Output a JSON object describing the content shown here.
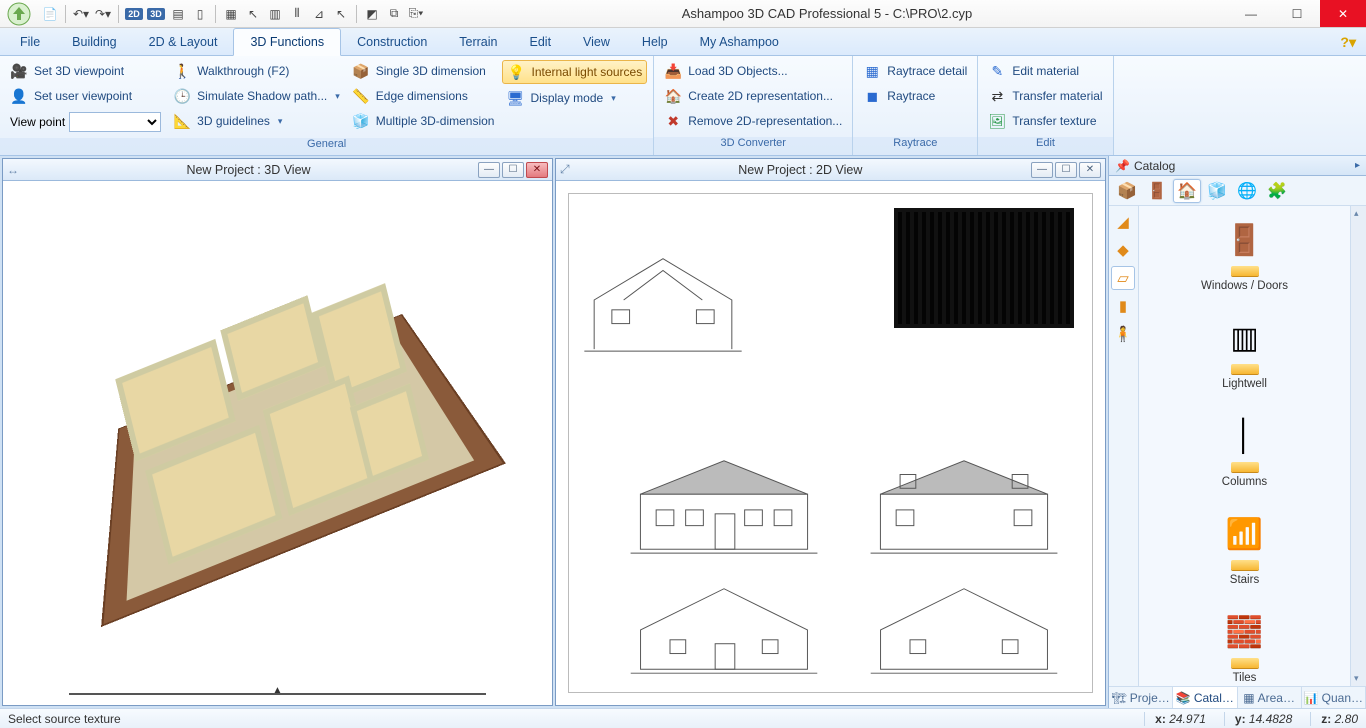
{
  "window": {
    "title": "Ashampoo 3D CAD Professional 5 - C:\\PRO\\2.cyp"
  },
  "menutabs": {
    "file": "File",
    "items": [
      "Building",
      "2D & Layout",
      "3D Functions",
      "Construction",
      "Terrain",
      "Edit",
      "View",
      "Help",
      "My Ashampoo"
    ],
    "active_index": 2
  },
  "ribbon": {
    "groups": [
      {
        "label": "General",
        "columns": [
          {
            "items": [
              {
                "icon": "🎥",
                "cls": "c-dark",
                "text": "Set 3D viewpoint"
              },
              {
                "icon": "👤",
                "cls": "c-dark",
                "text": "Set user viewpoint"
              },
              {
                "viewpoint_label": "View point"
              }
            ]
          },
          {
            "items": [
              {
                "icon": "🚶",
                "cls": "c-green",
                "text": "Walkthrough (F2)"
              },
              {
                "icon": "🕒",
                "cls": "c-orange",
                "text": "Simulate Shadow path...",
                "dd": true
              },
              {
                "icon": "📐",
                "cls": "c-green",
                "text": "3D guidelines",
                "dd": true
              }
            ]
          },
          {
            "items": [
              {
                "icon": "📦",
                "cls": "c-orange",
                "text": "Single 3D dimension"
              },
              {
                "icon": "📏",
                "cls": "c-blue",
                "text": "Edge dimensions"
              },
              {
                "icon": "🧊",
                "cls": "c-orange",
                "text": "Multiple 3D-dimension"
              }
            ]
          },
          {
            "items": [
              {
                "icon": "💡",
                "cls": "c-orange",
                "text": "Internal light sources",
                "highlight": true
              },
              {
                "icon": "🖥",
                "cls": "c-blue",
                "text": "Display mode",
                "dd": true
              }
            ]
          }
        ]
      },
      {
        "label": "3D Converter",
        "columns": [
          {
            "items": [
              {
                "icon": "📥",
                "cls": "c-orange",
                "text": "Load 3D Objects..."
              },
              {
                "icon": "🏠",
                "cls": "c-blue",
                "text": "Create 2D representation..."
              },
              {
                "icon": "✖",
                "cls": "c-red",
                "text": "Remove 2D-representation..."
              }
            ]
          }
        ]
      },
      {
        "label": "Raytrace",
        "columns": [
          {
            "items": [
              {
                "icon": "▦",
                "cls": "c-blue",
                "text": "Raytrace detail"
              },
              {
                "icon": "◼",
                "cls": "c-blue",
                "text": "Raytrace"
              }
            ]
          }
        ]
      },
      {
        "label": "Edit",
        "columns": [
          {
            "items": [
              {
                "icon": "✎",
                "cls": "c-blue",
                "text": "Edit material"
              },
              {
                "icon": "⇄",
                "cls": "c-dark",
                "text": "Transfer material"
              },
              {
                "icon": "🖼",
                "cls": "c-green",
                "text": "Transfer texture"
              }
            ]
          }
        ]
      }
    ]
  },
  "views": {
    "left": {
      "title": "New Project : 3D View"
    },
    "right": {
      "title": "New Project : 2D View"
    }
  },
  "catalog": {
    "title": "Catalog",
    "items": [
      {
        "label": "Windows / Doors",
        "glyph": "🚪"
      },
      {
        "label": "Lightwell",
        "glyph": "▥"
      },
      {
        "label": "Columns",
        "glyph": "│"
      },
      {
        "label": "Stairs",
        "glyph": "📶"
      },
      {
        "label": "Tiles",
        "glyph": "🧱"
      }
    ],
    "bottom_tabs": [
      "Proje…",
      "Catal…",
      "Area…",
      "Quan…"
    ],
    "bottom_active": 1
  },
  "status": {
    "message": "Select source texture",
    "x_label": "x:",
    "x": "24.971",
    "y_label": "y:",
    "y": "14.4828",
    "z_label": "z:",
    "z": "2.80"
  }
}
